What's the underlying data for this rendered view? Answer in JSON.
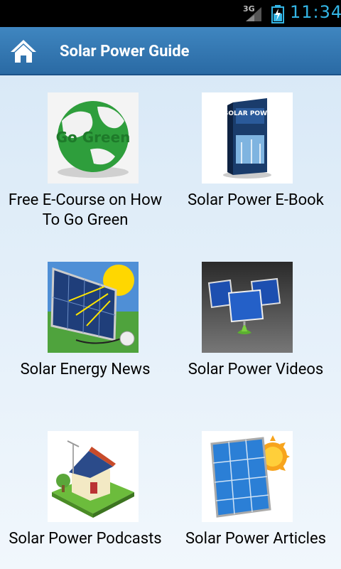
{
  "status_bar": {
    "network": "3G",
    "time": "11:34"
  },
  "action_bar": {
    "title": "Solar Power Guide"
  },
  "tiles": [
    {
      "label": "Free E-Course on How To Go Green",
      "image_text": "Go Green"
    },
    {
      "label": "Solar Power E-Book",
      "image_text": "SOLAR POWER"
    },
    {
      "label": "Solar Energy News"
    },
    {
      "label": "Solar Power Videos"
    },
    {
      "label": "Solar Power Podcasts"
    },
    {
      "label": "Solar Power Articles"
    }
  ],
  "colors": {
    "accent": "#33b5e5",
    "action_bar": "#3579b4",
    "background": "#e3eef8"
  }
}
